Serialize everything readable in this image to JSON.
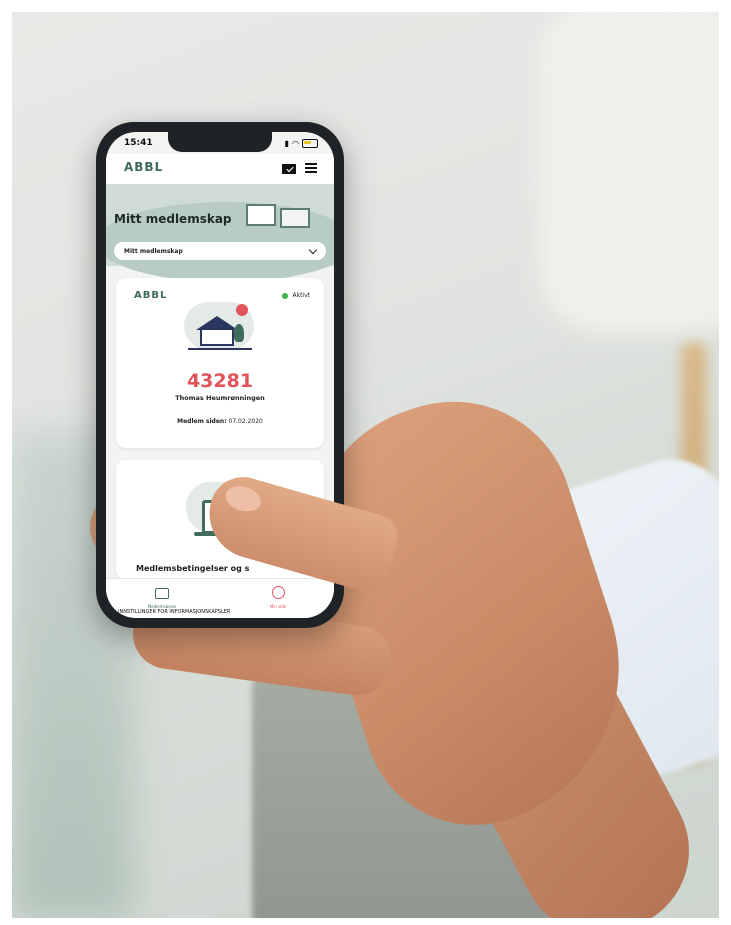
{
  "phone": {
    "status_time": "15:41",
    "app": {
      "logo": "ABBL",
      "page_title": "Mitt medlemskap",
      "dropdown_selected": "Mitt medlemskap",
      "membership_card": {
        "logo": "ABBL",
        "status": "Aktivt",
        "member_number": "43281",
        "member_name": "Thomas Heumrønningen",
        "member_since_label": "Medlem siden:",
        "member_since_value": "07.02.2020"
      },
      "terms_card_title": "Medlemsbetingelser og s",
      "bottom_nav": [
        {
          "label": "Medlemsbevis"
        },
        {
          "label": "Min side"
        }
      ],
      "cookie_bar_text": "INNSTILLINGER FOR INFORMASJONSKAPSLER"
    }
  },
  "colors": {
    "brand_green": "#3f6b5a",
    "accent_red": "#e1545b",
    "status_active": "#3db54a"
  }
}
